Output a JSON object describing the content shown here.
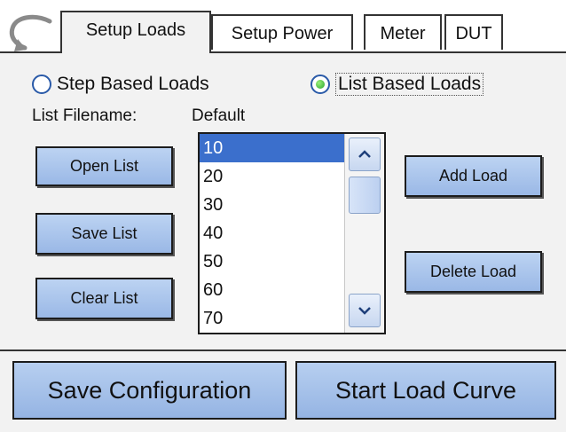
{
  "tabs": [
    {
      "label": "Setup Loads",
      "active": true
    },
    {
      "label": "Setup Power",
      "active": false
    },
    {
      "label": "Meter",
      "active": false
    },
    {
      "label": "DUT",
      "active": false
    }
  ],
  "mode": {
    "step_label": "Step Based Loads",
    "list_label": "List Based Loads",
    "selected": "list"
  },
  "filename": {
    "label": "List Filename:",
    "value": "Default"
  },
  "buttons": {
    "open_list": "Open List",
    "save_list": "Save List",
    "clear_list": "Clear List",
    "add_load": "Add Load",
    "delete_load": "Delete Load"
  },
  "load_list": {
    "items": [
      "10",
      "20",
      "30",
      "40",
      "50",
      "60",
      "70"
    ],
    "selected_index": 0
  },
  "bottom": {
    "save_configuration": "Save Configuration",
    "start_load_curve": "Start Load Curve"
  },
  "colors": {
    "button_blue": "#9ab8e6",
    "selection_blue": "#3b6fcc",
    "radio_green": "#27a52b"
  }
}
